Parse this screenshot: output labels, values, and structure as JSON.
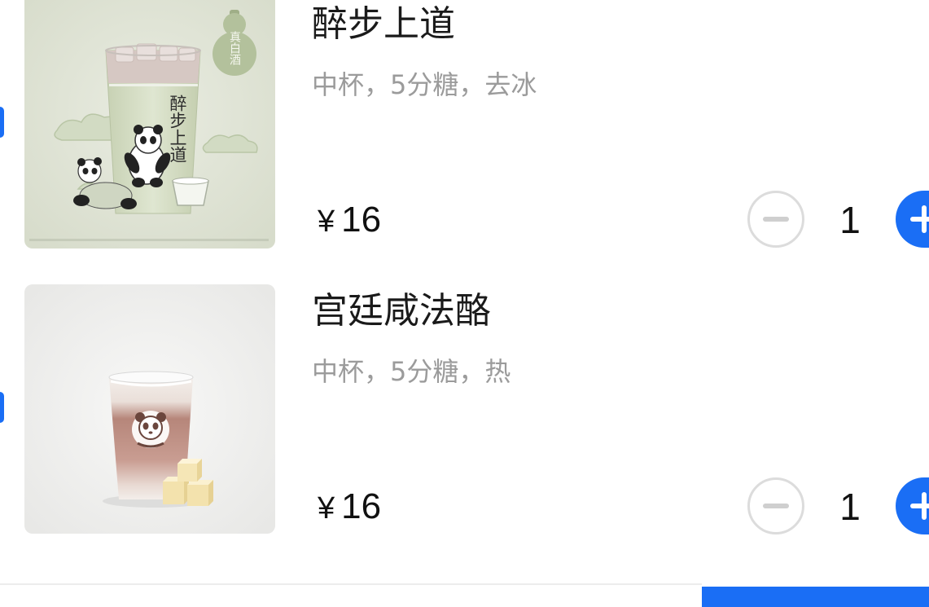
{
  "cart": {
    "items": [
      {
        "name": "醉步上道",
        "spec": "中杯，5分糖，去冰",
        "currency": "¥",
        "amount": 16,
        "quantity": 1,
        "selected": true,
        "image_text": {
          "label": "真白酒",
          "cup": "醉步上道"
        }
      },
      {
        "name": "宫廷咸法酪",
        "spec": "中杯，5分糖，热",
        "currency": "¥",
        "amount": 16,
        "quantity": 1,
        "selected": true
      }
    ]
  },
  "icons": {
    "select": "check-circle-icon",
    "decrease": "minus-icon",
    "increase": "plus-icon"
  },
  "colors": {
    "accent": "#1a6ef5",
    "title_text": "#1a1a1a",
    "spec_text": "#9b9b9b",
    "stepper_border": "#dcdcdc"
  }
}
